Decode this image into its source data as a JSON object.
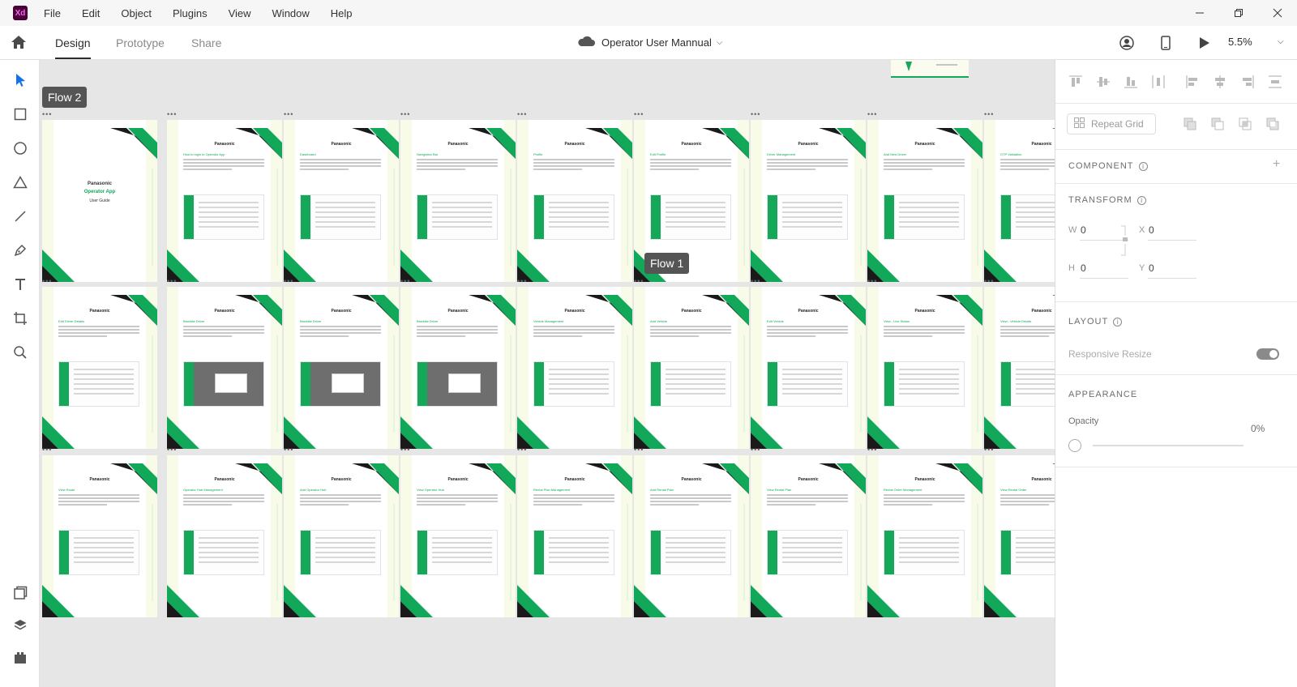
{
  "app": {
    "logo": "Xd"
  },
  "menu": [
    "File",
    "Edit",
    "Object",
    "Plugins",
    "View",
    "Window",
    "Help"
  ],
  "tabs": {
    "design": "Design",
    "prototype": "Prototype",
    "share": "Share"
  },
  "document": {
    "title": "Operator User Mannual"
  },
  "zoom": "5.5%",
  "flows": {
    "flow1": "Flow 1",
    "flow2": "Flow 2"
  },
  "artboards": {
    "brand": "Panasonic",
    "cover": {
      "app": "Operator App",
      "subtitle": "User Guide"
    },
    "rows": [
      [
        "How to login to Operator App",
        "Dashboard",
        "Navigation Bar",
        "Profile",
        "Edit Profile",
        "Driver Management",
        "Add New Driver",
        "OTP Validation"
      ],
      [
        "Edit Driver Details",
        "Blacklist Driver",
        "Blacklist Driver",
        "Blacklist Driver",
        "Vehicle Management",
        "Add Vehicle",
        "Edit Vehicle",
        "View - Live Status",
        "View - Vehicle Details"
      ],
      [
        "View Route",
        "Operator Hub Management",
        "Add Operator Hub",
        "View Operator Hub",
        "Rental Plan Management",
        "Add Rental Plan",
        "View Rental Plan",
        "Rental Order Management",
        "View Rental Order"
      ]
    ]
  },
  "right_panel": {
    "repeat_grid": "Repeat Grid",
    "component": "COMPONENT",
    "transform": "TRANSFORM",
    "w_label": "W",
    "w_value": "0",
    "x_label": "X",
    "x_value": "0",
    "h_label": "H",
    "h_value": "0",
    "y_label": "Y",
    "y_value": "0",
    "layout": "LAYOUT",
    "responsive_resize": "Responsive Resize",
    "appearance": "APPEARANCE",
    "opacity_label": "Opacity",
    "opacity_value": "0%"
  },
  "colors": {
    "brand_green": "#11a85a",
    "dark_stripe": "#1a1a1a",
    "flow_label_bg": "#555555"
  }
}
